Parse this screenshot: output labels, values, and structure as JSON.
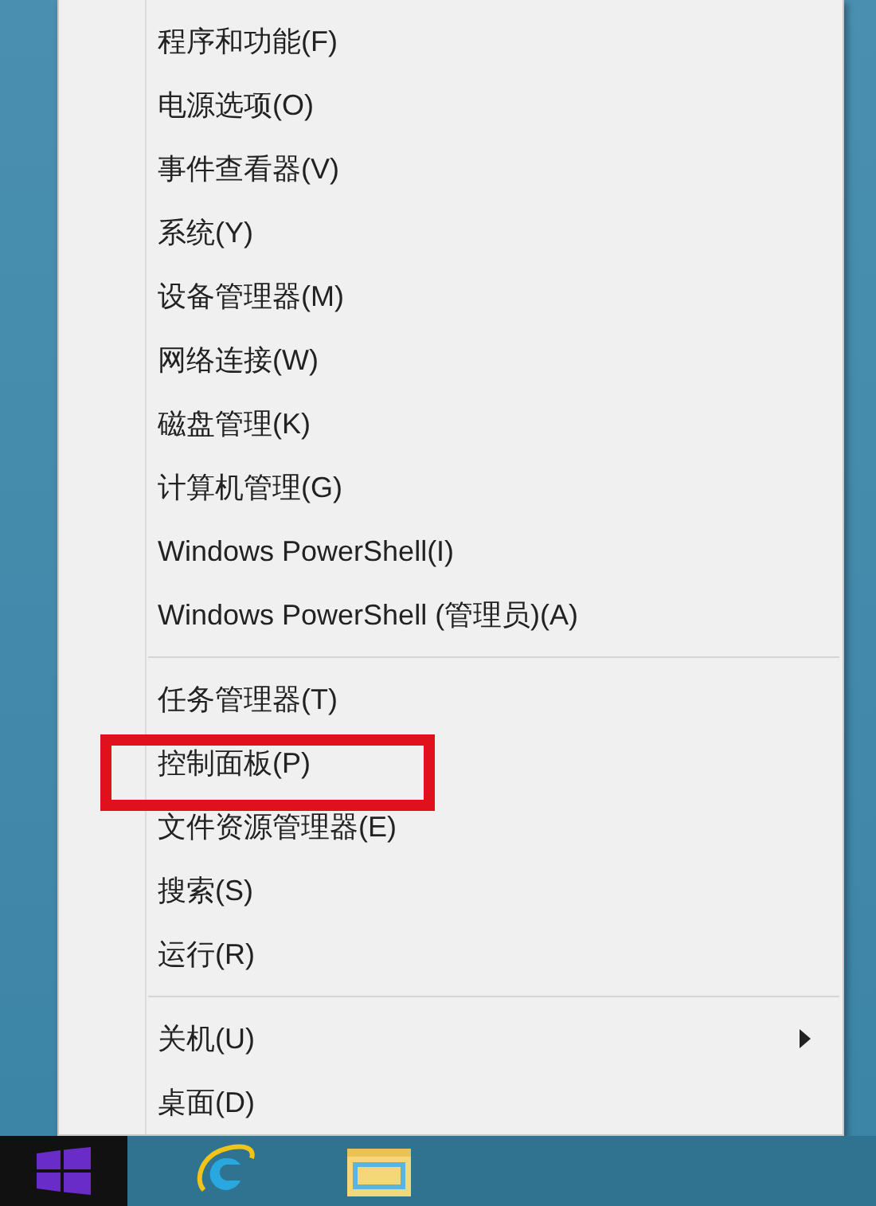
{
  "context_menu": {
    "groups": [
      {
        "items": [
          {
            "label": "程序和功能(F)",
            "highlighted": false,
            "submenu": false
          },
          {
            "label": "电源选项(O)",
            "highlighted": false,
            "submenu": false
          },
          {
            "label": "事件查看器(V)",
            "highlighted": false,
            "submenu": false
          },
          {
            "label": "系统(Y)",
            "highlighted": false,
            "submenu": false
          },
          {
            "label": "设备管理器(M)",
            "highlighted": false,
            "submenu": false
          },
          {
            "label": "网络连接(W)",
            "highlighted": false,
            "submenu": false
          },
          {
            "label": "磁盘管理(K)",
            "highlighted": false,
            "submenu": false
          },
          {
            "label": "计算机管理(G)",
            "highlighted": false,
            "submenu": false
          },
          {
            "label": "Windows PowerShell(I)",
            "highlighted": false,
            "submenu": false
          },
          {
            "label": "Windows PowerShell (管理员)(A)",
            "highlighted": false,
            "submenu": false
          }
        ]
      },
      {
        "items": [
          {
            "label": "任务管理器(T)",
            "highlighted": false,
            "submenu": false
          },
          {
            "label": "控制面板(P)",
            "highlighted": true,
            "submenu": false
          },
          {
            "label": "文件资源管理器(E)",
            "highlighted": false,
            "submenu": false
          },
          {
            "label": "搜索(S)",
            "highlighted": false,
            "submenu": false
          },
          {
            "label": "运行(R)",
            "highlighted": false,
            "submenu": false
          }
        ]
      },
      {
        "items": [
          {
            "label": "关机(U)",
            "highlighted": false,
            "submenu": true
          },
          {
            "label": "桌面(D)",
            "highlighted": false,
            "submenu": false
          }
        ]
      }
    ]
  }
}
